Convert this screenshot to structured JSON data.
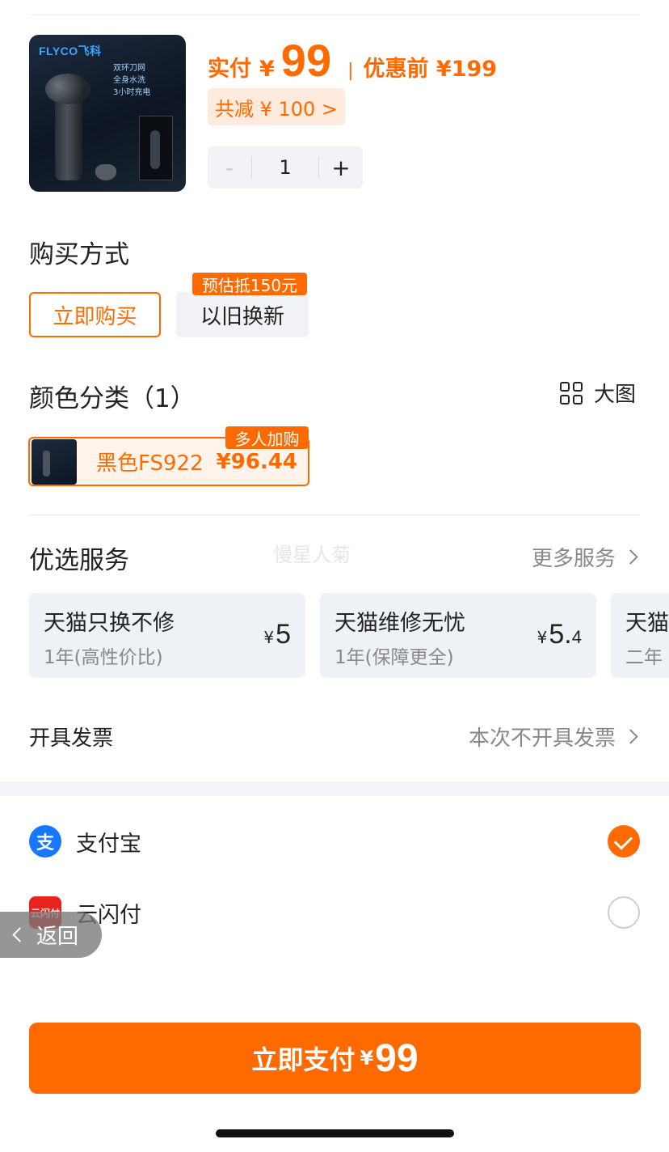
{
  "product": {
    "brand_logo": "FLYCO飞科",
    "image_features": [
      "双环刀网",
      "全身水洗",
      "3小时充电"
    ],
    "price_label": "实付",
    "currency": "¥",
    "price": "99",
    "price_separator": "|",
    "original_price": "优惠前 ¥199",
    "discount": "共减 ¥ 100 >",
    "quantity": "1",
    "minus": "-",
    "plus": "+"
  },
  "purchase_method": {
    "title": "购买方式",
    "options": [
      {
        "label": "立即购买",
        "selected": true
      },
      {
        "label": "以旧换新",
        "selected": false,
        "tag": "预估抵150元"
      }
    ]
  },
  "color": {
    "title": "颜色分类（1）",
    "big_view": "大图",
    "variant": {
      "name": "黑色FS922",
      "price": "¥96.44",
      "tag": "多人加购"
    }
  },
  "watermark": "慢星人菊",
  "services": {
    "title": "优选服务",
    "more": "更多服务",
    "items": [
      {
        "name": "天猫只换不修",
        "sub": "1年(高性价比)",
        "yen": "¥",
        "price_int": "5",
        "price_dec": ""
      },
      {
        "name": "天猫维修无忧",
        "sub": "1年(保障更全)",
        "yen": "¥",
        "price_int": "5.",
        "price_dec": "4"
      },
      {
        "name": "天猫",
        "sub": "二年"
      }
    ]
  },
  "invoice": {
    "label": "开具发票",
    "value": "本次不开具发票"
  },
  "payment": {
    "methods": [
      {
        "name": "支付宝",
        "icon": "alipay-icon",
        "icon_text": "支",
        "selected": true
      },
      {
        "name": "云闪付",
        "icon": "unionpay-icon",
        "icon_text": "云闪付",
        "selected": false
      }
    ]
  },
  "back": "返回",
  "pay_button": {
    "label": "立即支付",
    "currency": "¥",
    "amount": "99"
  },
  "colors": {
    "accent": "#ff6a00",
    "alipay": "#1677ff",
    "unionpay": "#e8221c"
  }
}
